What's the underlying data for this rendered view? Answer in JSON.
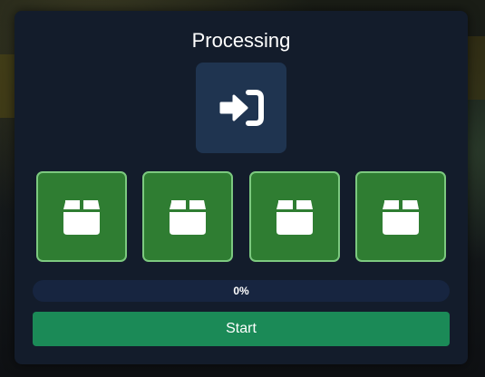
{
  "dialog": {
    "title": "Processing",
    "action_icon": "sign-in-icon"
  },
  "slots": [
    {
      "icon": "box-icon",
      "color": "#2f7d32"
    },
    {
      "icon": "box-icon",
      "color": "#2f7d32"
    },
    {
      "icon": "box-icon",
      "color": "#2f7d32"
    },
    {
      "icon": "box-icon",
      "color": "#2f7d32"
    }
  ],
  "progress": {
    "value": 0,
    "label": "0%"
  },
  "start_button": {
    "label": "Start",
    "color": "#1b8a57"
  },
  "colors": {
    "panel": "#131c2b",
    "action_tile": "#1f3450",
    "slot_border": "#7cc97f",
    "progress_track": "#172540"
  }
}
